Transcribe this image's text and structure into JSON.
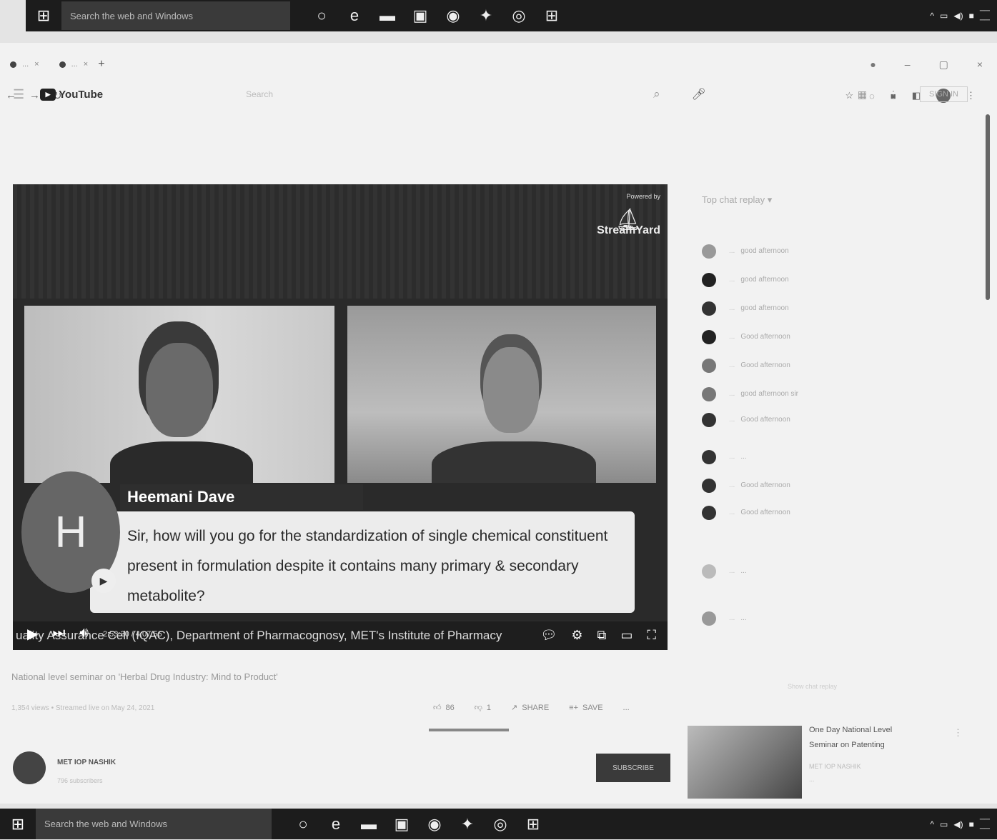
{
  "taskbar": {
    "search_placeholder": "Search the web and Windows",
    "icons": [
      "start-icon",
      "cortana-icon",
      "edge-icon",
      "file-explorer-icon",
      "store-icon",
      "app-icon",
      "app-icon",
      "chrome-icon",
      "windows-icon"
    ],
    "bottom_search_placeholder": "Search the web and Windows"
  },
  "browser": {
    "tab_1_label": "...",
    "tab_2_label": "...",
    "url": "..."
  },
  "youtube": {
    "logo_text": "YouTube",
    "search_placeholder": "Search",
    "sign_in_label": "SIGN IN"
  },
  "video": {
    "powered_by_label": "Powered by",
    "powered_brand": "StreamYard",
    "commenter_name": "Heemani Dave",
    "avatar_letter": "H",
    "question_text": "Sir, how will you go for the standardization of single chemical constituent present in formulation despite it contains many primary & secondary metabolite?",
    "ticker_text": "uality Assurance Cell (IQAC), Department of Pharmacognosy, MET's Institute of Pharmacy",
    "time_readout": "2:53:30 / 4:07:56"
  },
  "below_video": {
    "title": "National level seminar on 'Herbal Drug Industry: Mind to Product'",
    "meta": "1,354 views • Streamed live on May 24, 2021",
    "like_count": "86",
    "dislike_count": "1",
    "share_label": "SHARE",
    "save_label": "SAVE",
    "more_label": "...",
    "channel_name": "MET IOP NASHIK",
    "subscribers": "796 subscribers",
    "subscribe_label": "SUBSCRIBE"
  },
  "chat": {
    "header": "Top chat replay ▾",
    "items": [
      {
        "author": "...",
        "text": "good afternoon"
      },
      {
        "author": "...",
        "text": "good afternoon"
      },
      {
        "author": "...",
        "text": "good afternoon"
      },
      {
        "author": "...",
        "text": "Good afternoon"
      },
      {
        "author": "...",
        "text": "Good afternoon"
      },
      {
        "author": "...",
        "text": "good afternoon sir"
      },
      {
        "author": "...",
        "text": "Good afternoon"
      },
      {
        "author": "...",
        "text": "..."
      },
      {
        "author": "...",
        "text": "Good afternoon"
      },
      {
        "author": "...",
        "text": "Good afternoon"
      },
      {
        "author": "...",
        "text": "..."
      },
      {
        "author": "...",
        "text": "..."
      },
      {
        "author": "...",
        "text": "..."
      }
    ],
    "show_more": "Show chat replay"
  },
  "recommendation": {
    "title": "One Day National Level Seminar on Patenting",
    "channel": "MET IOP NASHIK",
    "views": "..."
  }
}
